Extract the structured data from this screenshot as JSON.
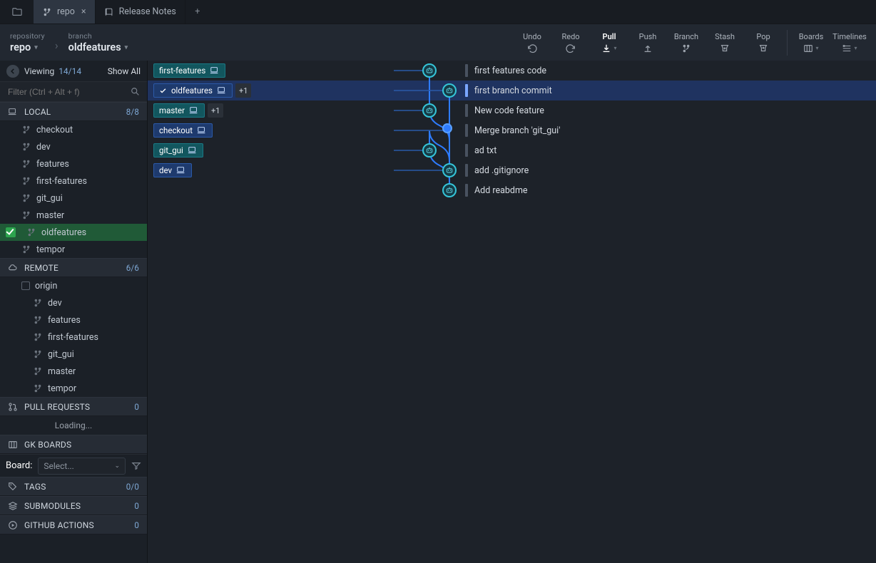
{
  "tabs": [
    {
      "icon": "branch",
      "label": "repo",
      "closable": true,
      "active": true
    },
    {
      "icon": "book",
      "label": "Release Notes",
      "closable": false,
      "active": false
    }
  ],
  "breadcrumb": {
    "repo_label": "repository",
    "repo_value": "repo",
    "branch_label": "branch",
    "branch_value": "oldfeatures"
  },
  "toolbar": {
    "undo": "Undo",
    "redo": "Redo",
    "pull": "Pull",
    "push": "Push",
    "branch": "Branch",
    "stash": "Stash",
    "pop": "Pop",
    "boards": "Boards",
    "timelines": "Timelines"
  },
  "filter": {
    "viewing": "Viewing",
    "count": "14/14",
    "show_all": "Show All",
    "placeholder": "Filter (Ctrl + Alt + f)"
  },
  "sections": {
    "local": {
      "label": "LOCAL",
      "count": "8/8"
    },
    "remote": {
      "label": "REMOTE",
      "count": "6/6"
    },
    "pull_requests": {
      "label": "PULL REQUESTS",
      "count": "0"
    },
    "gk_boards": {
      "label": "GK BOARDS"
    },
    "tags": {
      "label": "TAGS",
      "count": "0/0"
    },
    "submodules": {
      "label": "SUBMODULES",
      "count": "0"
    },
    "github_actions": {
      "label": "GITHUB ACTIONS",
      "count": "0"
    }
  },
  "local_branches": [
    "checkout",
    "dev",
    "features",
    "first-features",
    "git_gui",
    "master",
    "oldfeatures",
    "tempor"
  ],
  "active_local": "oldfeatures",
  "remote_origin": "origin",
  "remote_branches": [
    "dev",
    "features",
    "first-features",
    "git_gui",
    "master",
    "tempor"
  ],
  "loading": "Loading...",
  "board": {
    "label": "Board:",
    "placeholder": "Select..."
  },
  "commits": [
    {
      "chip": "first-features",
      "chip_style": "teal",
      "chip_icon": "laptop",
      "count": null,
      "lane": 0,
      "msg": "first features code",
      "selected": false
    },
    {
      "chip": "oldfeatures",
      "chip_style": "blue",
      "chip_icon": "laptop",
      "check": true,
      "count": "+1",
      "lane": 1,
      "msg": "first branch commit",
      "selected": true
    },
    {
      "chip": "master",
      "chip_style": "teal",
      "chip_icon": "laptop",
      "count": "+1",
      "lane": 0,
      "msg": "New code feature",
      "selected": false
    },
    {
      "chip": "checkout",
      "chip_style": "blue",
      "chip_icon": "laptop",
      "count": null,
      "lane": 1,
      "dot": true,
      "msg": "Merge branch 'git_gui'",
      "selected": false
    },
    {
      "chip": "git_gui",
      "chip_style": "teal",
      "chip_icon": "laptop",
      "count": null,
      "lane": 0,
      "msg": "ad txt",
      "selected": false
    },
    {
      "chip": "dev",
      "chip_style": "blue",
      "chip_icon": "laptop",
      "count": null,
      "lane": 1,
      "msg": "add .gitignore",
      "selected": false
    },
    {
      "chip": null,
      "lane": 1,
      "msg": "Add reabdme",
      "selected": false
    }
  ]
}
